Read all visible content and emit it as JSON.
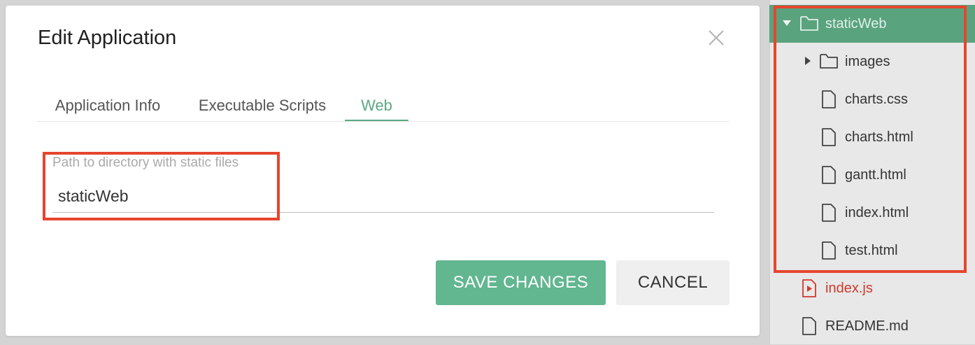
{
  "dialog": {
    "title": "Edit Application",
    "tabs": [
      {
        "label": "Application Info",
        "active": false
      },
      {
        "label": "Executable Scripts",
        "active": false
      },
      {
        "label": "Web",
        "active": true
      }
    ],
    "field": {
      "label": "Path to directory with static files",
      "value": "staticWeb"
    },
    "buttons": {
      "save": "SAVE CHANGES",
      "cancel": "CANCEL"
    }
  },
  "file_tree": {
    "items": [
      {
        "name": "staticWeb",
        "type": "folder",
        "expanded": true,
        "selected": true
      },
      {
        "name": "images",
        "type": "folder",
        "expanded": false
      },
      {
        "name": "charts.css",
        "type": "file"
      },
      {
        "name": "charts.html",
        "type": "file"
      },
      {
        "name": "gantt.html",
        "type": "file"
      },
      {
        "name": "index.html",
        "type": "file"
      },
      {
        "name": "test.html",
        "type": "file"
      },
      {
        "name": "index.js",
        "type": "script-file"
      },
      {
        "name": "README.md",
        "type": "file"
      }
    ]
  },
  "colors": {
    "accent": "#5aa883",
    "save_button": "#62b690",
    "highlight": "#e6452e",
    "selected_row": "#5aa37f",
    "script_file": "#d0392b"
  },
  "icons": [
    "close-icon",
    "folder-icon",
    "file-icon",
    "script-file-icon",
    "caret-down-icon",
    "caret-right-icon"
  ]
}
